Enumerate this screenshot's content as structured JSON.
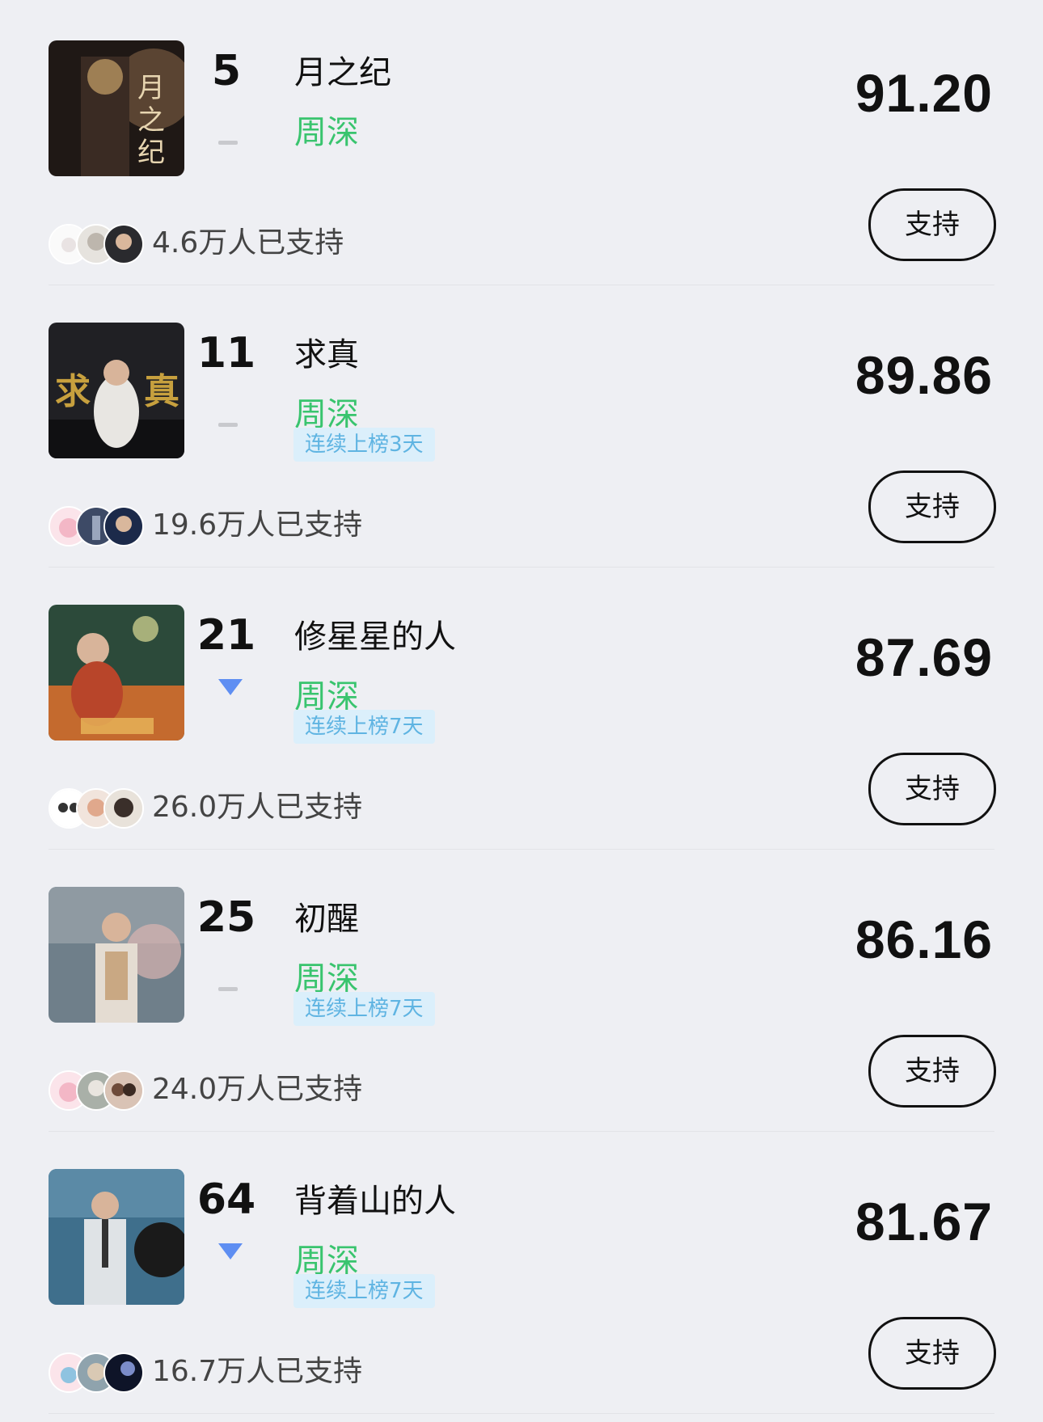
{
  "entries": [
    {
      "rank": "5",
      "trend": "flat",
      "title": "月之纪",
      "artist": "周深",
      "streak": "",
      "score": "91.20",
      "supporters": "4.6万人已支持",
      "button": "支持",
      "cover_colors": [
        "#1f1815",
        "#8a6a4a",
        "#c9a46a"
      ]
    },
    {
      "rank": "11",
      "trend": "flat",
      "title": "求真",
      "artist": "周深",
      "streak": "连续上榜3天",
      "score": "89.86",
      "supporters": "19.6万人已支持",
      "button": "支持",
      "cover_colors": [
        "#202024",
        "#e8e6e2",
        "#c7a03e"
      ]
    },
    {
      "rank": "21",
      "trend": "down",
      "title": "修星星的人",
      "artist": "周深",
      "streak": "连续上榜7天",
      "score": "87.69",
      "supporters": "26.0万人已支持",
      "button": "支持",
      "cover_colors": [
        "#2c4a3a",
        "#c46a2e",
        "#e8b65a"
      ]
    },
    {
      "rank": "25",
      "trend": "flat",
      "title": "初醒",
      "artist": "周深",
      "streak": "连续上榜7天",
      "score": "86.16",
      "supporters": "24.0万人已支持",
      "button": "支持",
      "cover_colors": [
        "#6f7f8a",
        "#e4dcd2",
        "#b8864f"
      ]
    },
    {
      "rank": "64",
      "trend": "down",
      "title": "背着山的人",
      "artist": "周深",
      "streak": "连续上榜7天",
      "score": "81.67",
      "supporters": "16.7万人已支持",
      "button": "支持",
      "cover_colors": [
        "#3f6f8c",
        "#dfe3e6",
        "#b07a5c"
      ]
    }
  ]
}
